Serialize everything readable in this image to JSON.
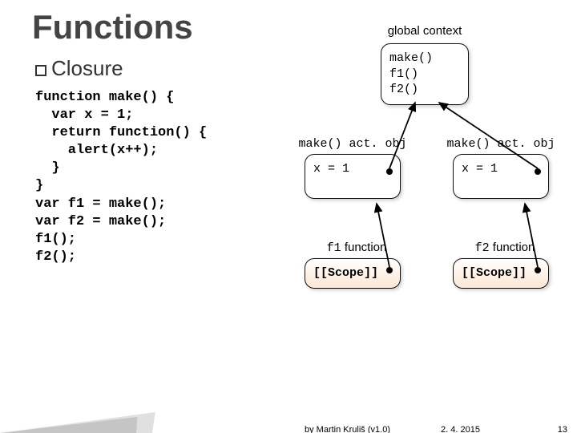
{
  "title": "Functions",
  "subtitle": "Closure",
  "code": "function make() {\n  var x = 1;\n  return function() {\n    alert(x++);\n  }\n}\nvar f1 = make();\nvar f2 = make();\nf1();\nf2();",
  "diagram": {
    "global_label": "global context",
    "global_box": "make()\nf1()\nf2()",
    "act_obj_left": "make() act. obj",
    "act_obj_right": "make() act. obj",
    "x_left": "x = 1",
    "x_right": "x = 1",
    "f1_label": "f1 function",
    "f2_label": "f2 function",
    "scope_left": "[[Scope]]",
    "scope_right": "[[Scope]]"
  },
  "footer": {
    "author": "by Martin Kruliš (v1.0)",
    "date": "2. 4. 2015",
    "page": "13"
  }
}
